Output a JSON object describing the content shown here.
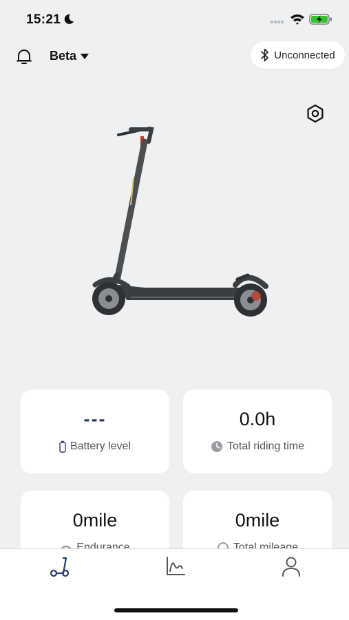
{
  "status_bar": {
    "time": "15:21",
    "icons": [
      "moon-icon",
      "signal-icon",
      "wifi-icon",
      "battery-charging-icon"
    ]
  },
  "header": {
    "device_name": "Beta",
    "connection_status": "Unconnected",
    "icons": [
      "bell-icon",
      "caret-down-icon",
      "bluetooth-icon"
    ]
  },
  "settings": {
    "icon": "settings-icon"
  },
  "stats": {
    "battery": {
      "value": "---",
      "label": "Battery level",
      "icon": "battery-icon"
    },
    "riding_time": {
      "value": "0.0h",
      "label": "Total riding time",
      "icon": "clock-icon"
    },
    "endurance": {
      "value": "0mile",
      "label": "Endurance",
      "icon": "gauge-icon"
    },
    "total_mileage": {
      "value": "0mile",
      "label": "Total mileage",
      "icon": "odometer-icon"
    }
  },
  "tabbar": {
    "tabs": [
      {
        "name": "scooter",
        "icon": "scooter-icon",
        "active": true
      },
      {
        "name": "chart",
        "icon": "chart-icon",
        "active": false
      },
      {
        "name": "profile",
        "icon": "user-icon",
        "active": false
      }
    ]
  },
  "colors": {
    "background": "#eef0f2",
    "card": "#ffffff",
    "accent": "#2b3a6b",
    "charging": "#3cbf2e"
  }
}
